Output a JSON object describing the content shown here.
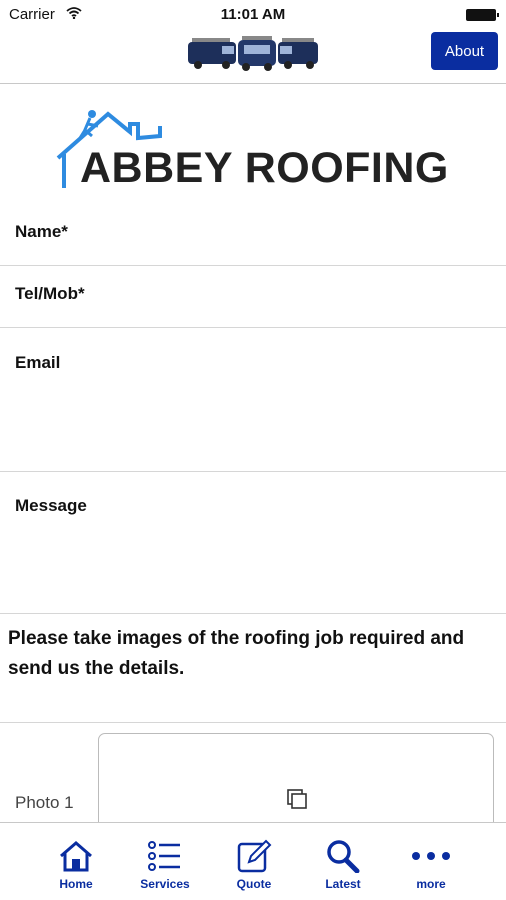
{
  "status_bar": {
    "carrier": "Carrier",
    "time": "11:01 AM"
  },
  "header": {
    "about_label": "About"
  },
  "logo": {
    "text": "ABBEY ROOFING"
  },
  "form": {
    "fields": [
      {
        "label": "Name*"
      },
      {
        "label": "Tel/Mob*"
      },
      {
        "label": "Email"
      },
      {
        "label": "Message"
      }
    ],
    "instructions": "Please take images of the roofing job required and send us the details.",
    "photo_label": "Photo 1"
  },
  "tab_bar": {
    "items": [
      {
        "label": "Home",
        "icon": "home-icon"
      },
      {
        "label": "Services",
        "icon": "list-icon"
      },
      {
        "label": "Quote",
        "icon": "edit-icon"
      },
      {
        "label": "Latest",
        "icon": "search-icon"
      },
      {
        "label": "more",
        "icon": "more-icon"
      }
    ]
  },
  "colors": {
    "accent": "#0a2da0",
    "logo_blue": "#2e8be0"
  }
}
